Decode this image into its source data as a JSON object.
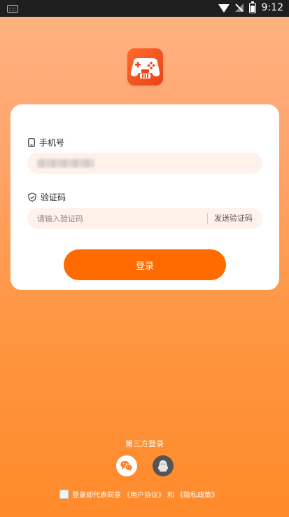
{
  "status": {
    "time": "9:12"
  },
  "card": {
    "phone_label": "手机号",
    "code_label": "验证码",
    "code_placeholder": "请输入验证码",
    "send_code": "发送验证码",
    "login_button": "登录"
  },
  "third_party": {
    "title": "第三方登录"
  },
  "agreement": {
    "prefix": "登录即代表同意",
    "user_agreement": "《用户协议》",
    "and": "和",
    "privacy_policy": "《隐私政策》"
  },
  "colors": {
    "accent": "#ff6b00",
    "field_bg": "#fef2ea"
  }
}
